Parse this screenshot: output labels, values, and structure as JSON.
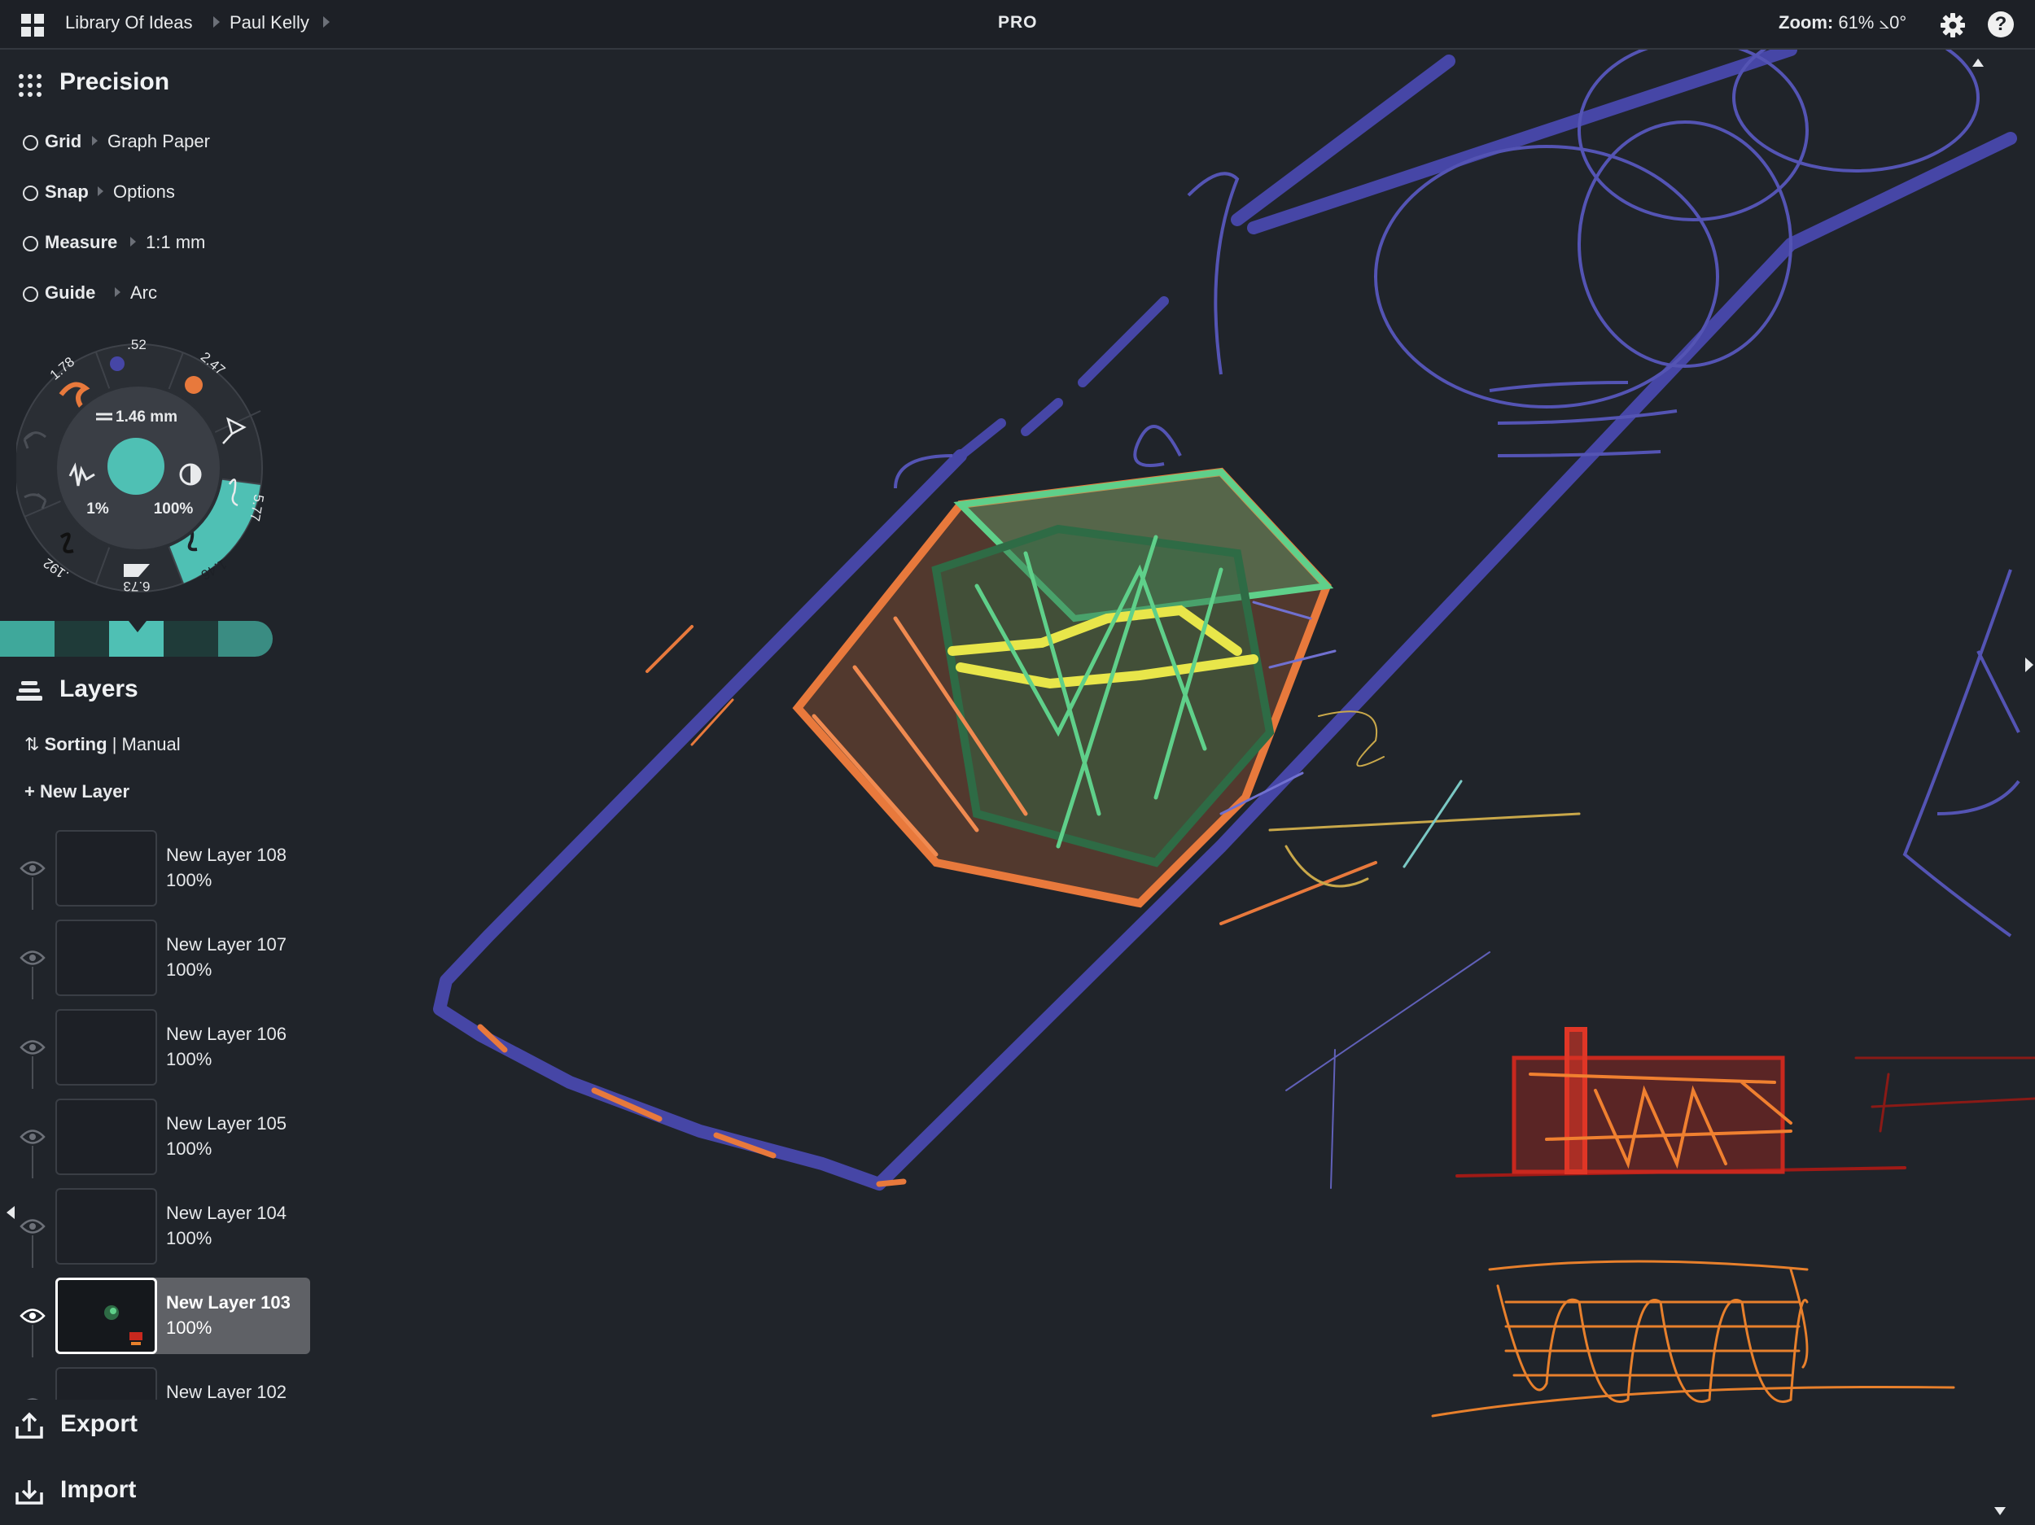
{
  "topbar": {
    "breadcrumb_1": "Library Of Ideas",
    "breadcrumb_2": "Paul Kelly",
    "badge": "PRO",
    "zoom_label": "Zoom:",
    "zoom_value": "61% ⦣0°",
    "help_label": "?"
  },
  "precision": {
    "title": "Precision",
    "rows": [
      {
        "name": "Grid",
        "value": "Graph Paper"
      },
      {
        "name": "Snap",
        "value": "Options"
      },
      {
        "name": "Measure",
        "value": "1:1 mm"
      },
      {
        "name": "Guide",
        "value": "Arc"
      }
    ]
  },
  "tool_wheel": {
    "size_label": "1.46 mm",
    "smoothing": "1%",
    "opacity": "100%",
    "presets": [
      ".52",
      "2.47",
      "5.77",
      "1.46",
      "6.73",
      ".192",
      "1.78"
    ]
  },
  "colors": {
    "accent": "#4fc0b4",
    "swatches": [
      "#3fa89b",
      "#1f3b39",
      "#4fc0b4",
      "#1f3b39",
      "#3a8c82"
    ],
    "stroke_blue": "#4646a6",
    "stroke_orange": "#e8793c",
    "stroke_green": "#5fd08a",
    "stroke_yellow": "#e8e64a",
    "stroke_red": "#c8281e"
  },
  "layers": {
    "title": "Layers",
    "sorting_label": "Sorting",
    "sorting_value": "| Manual",
    "new_layer": "New Layer",
    "items": [
      {
        "name": "New Layer 108",
        "opacity": "100%"
      },
      {
        "name": "New Layer 107",
        "opacity": "100%"
      },
      {
        "name": "New Layer 106",
        "opacity": "100%"
      },
      {
        "name": "New Layer 105",
        "opacity": "100%"
      },
      {
        "name": "New Layer 104",
        "opacity": "100%"
      },
      {
        "name": "New Layer 103",
        "opacity": "100%"
      },
      {
        "name": "New Layer 102",
        "opacity": ""
      }
    ]
  },
  "bottom": {
    "export": "Export",
    "import": "Import"
  }
}
